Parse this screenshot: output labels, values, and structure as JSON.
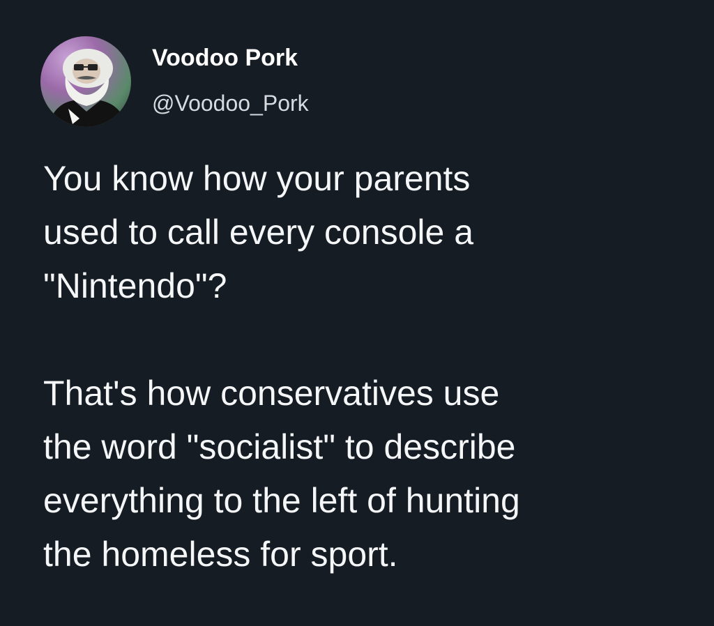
{
  "tweet": {
    "author": {
      "display_name": "Voodoo Pork",
      "handle": "@Voodoo_Pork",
      "avatar_icon": "bearded-man-portrait-avatar"
    },
    "paragraphs": [
      "You know how your parents\nused to call every console a\n\"Nintendo\"?",
      "That's how conservatives use\nthe word \"socialist\" to describe\neverything to the left of hunting\nthe homeless for sport."
    ]
  },
  "colors": {
    "background": "#161c24",
    "text": "#f4f6f8",
    "handle": "#d6dbe0"
  }
}
